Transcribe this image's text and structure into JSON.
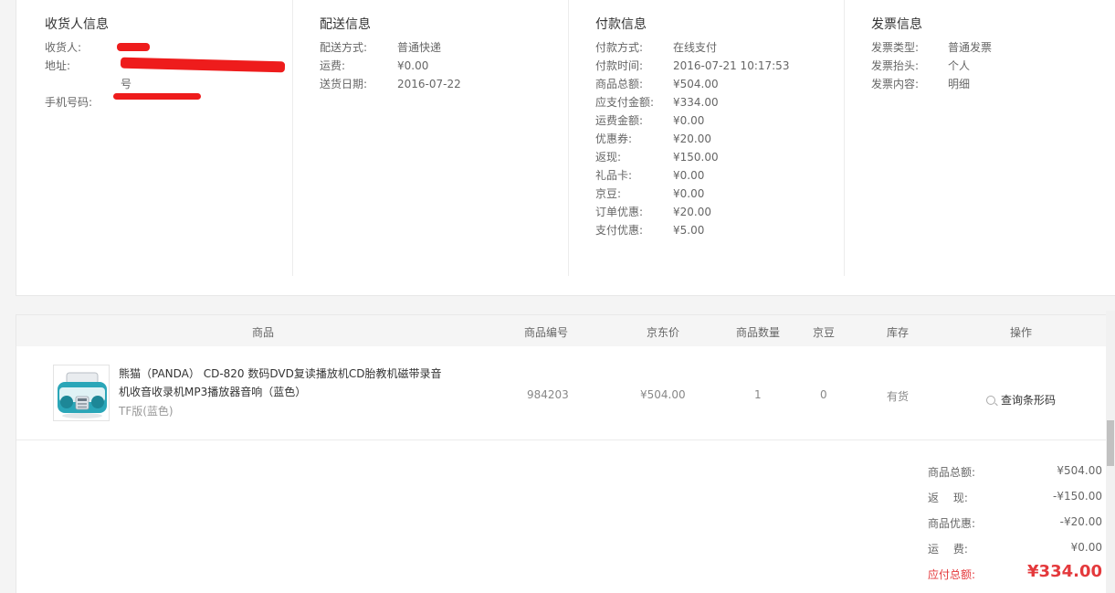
{
  "consignee": {
    "title": "收货人信息",
    "name_label": "收货人:",
    "addr_label": "地址:",
    "addr_tail": "号",
    "phone_label": "手机号码:"
  },
  "delivery": {
    "title": "配送信息",
    "rows": [
      {
        "label": "配送方式:",
        "value": "普通快递"
      },
      {
        "label": "运费:",
        "value": "¥0.00"
      },
      {
        "label": "送货日期:",
        "value": "2016-07-22"
      }
    ]
  },
  "payment": {
    "title": "付款信息",
    "rows": [
      {
        "label": "付款方式:",
        "value": "在线支付"
      },
      {
        "label": "付款时间:",
        "value": "2016-07-21 10:17:53"
      },
      {
        "label": "商品总额:",
        "value": "¥504.00"
      },
      {
        "label": "应支付金额:",
        "value": "¥334.00"
      },
      {
        "label": "运费金额:",
        "value": "¥0.00"
      },
      {
        "label": "优惠券:",
        "value": "¥20.00"
      },
      {
        "label": "返现:",
        "value": "¥150.00"
      },
      {
        "label": "礼品卡:",
        "value": "¥0.00"
      },
      {
        "label": "京豆:",
        "value": "¥0.00"
      },
      {
        "label": "订单优惠:",
        "value": "¥20.00"
      },
      {
        "label": "支付优惠:",
        "value": "¥5.00"
      }
    ]
  },
  "invoice": {
    "title": "发票信息",
    "rows": [
      {
        "label": "发票类型:",
        "value": "普通发票"
      },
      {
        "label": "发票抬头:",
        "value": "个人"
      },
      {
        "label": "发票内容:",
        "value": "明细"
      }
    ]
  },
  "goods_table": {
    "headers": [
      "商品",
      "商品编号",
      "京东价",
      "商品数量",
      "京豆",
      "库存",
      "操作"
    ],
    "item": {
      "name": "熊猫（PANDA） CD-820 数码DVD复读播放机CD胎教机磁带录音机收音收录机MP3播放器音响（蓝色）",
      "spec": "TF版(蓝色)",
      "sku": "984203",
      "price": "¥504.00",
      "qty": "1",
      "jingdou": "0",
      "stock": "有货",
      "action": "查询条形码"
    }
  },
  "totals": {
    "rows": [
      {
        "label": "商品总额:",
        "value": "¥504.00"
      },
      {
        "label": "返　 现:",
        "value": "-¥150.00"
      },
      {
        "label": "商品优惠:",
        "value": "-¥20.00"
      },
      {
        "label": "运　 费:",
        "value": "¥0.00"
      }
    ],
    "grand_label": "应付总额:",
    "grand_value": "¥334.00"
  },
  "colors": {
    "accent_red": "#e4393c",
    "redaction": "#ee1c1c",
    "teal_product": "#2aa6b8"
  }
}
